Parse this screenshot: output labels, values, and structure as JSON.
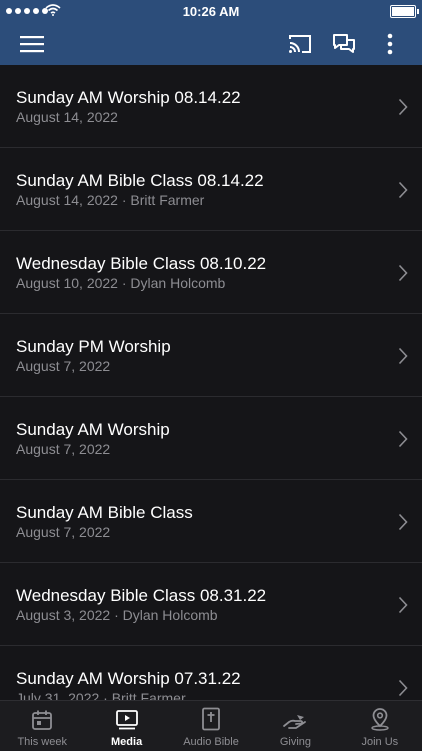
{
  "status_bar": {
    "time": "10:26 AM"
  },
  "app_bar": {
    "icons": [
      "hamburger-menu-icon",
      "cast-icon",
      "chat-bubbles-icon",
      "more-vertical-icon"
    ]
  },
  "items": [
    {
      "title": "Sunday AM Worship 08.14.22",
      "subtitle": "August 14, 2022"
    },
    {
      "title": "Sunday AM Bible Class 08.14.22",
      "subtitle": "August 14, 2022 · Britt Farmer"
    },
    {
      "title": "Wednesday Bible Class 08.10.22",
      "subtitle": "August 10, 2022 · Dylan Holcomb"
    },
    {
      "title": "Sunday PM Worship",
      "subtitle": "August 7, 2022"
    },
    {
      "title": "Sunday AM Worship",
      "subtitle": "August 7, 2022"
    },
    {
      "title": "Sunday AM Bible Class",
      "subtitle": "August 7, 2022"
    },
    {
      "title": "Wednesday Bible Class 08.31.22",
      "subtitle": "August 3, 2022 · Dylan Holcomb"
    },
    {
      "title": "Sunday AM Worship 07.31.22",
      "subtitle": "July 31, 2022 · Britt Farmer"
    }
  ],
  "tabs": [
    {
      "label": "This week",
      "icon": "calendar-icon",
      "active": false
    },
    {
      "label": "Media",
      "icon": "media-play-icon",
      "active": true
    },
    {
      "label": "Audio Bible",
      "icon": "bible-icon",
      "active": false
    },
    {
      "label": "Giving",
      "icon": "giving-hand-icon",
      "active": false
    },
    {
      "label": "Join Us",
      "icon": "location-pin-icon",
      "active": false
    }
  ],
  "colors": {
    "header": "#2c4d7a",
    "background": "#151518",
    "tab_inactive": "#8e8e93",
    "tab_active": "#ffffff"
  }
}
